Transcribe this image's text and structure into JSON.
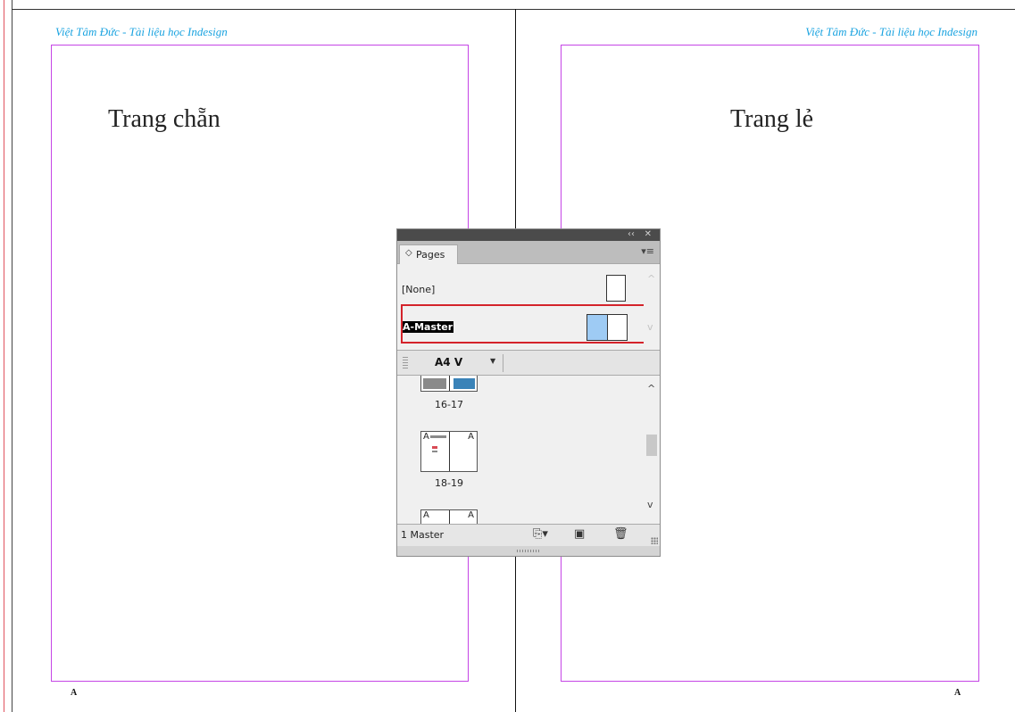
{
  "document": {
    "header_left": "Việt Tâm Đức - Tài liệu học Indesign",
    "header_right": "Việt Tâm Đức - Tài liệu học Indesign",
    "left_page_label": "Trang chẵn",
    "right_page_label": "Trang lẻ",
    "left_page_marker": "A",
    "right_page_marker": "A",
    "colors": {
      "header_text": "#1aa3e0",
      "margin_guide": "#c545e6"
    }
  },
  "pages_panel": {
    "collapse_icon": "double-left-arrow-icon",
    "collapse_glyph": "‹‹",
    "close_glyph": "✕",
    "tab_label": "Pages",
    "tab_glyph": "◇",
    "menu_glyph": "▾≡",
    "masters": [
      {
        "name": "[None]",
        "selected": false
      },
      {
        "name": "A-Master",
        "selected": true
      }
    ],
    "page_size": "A4 V",
    "page_size_arrow": "▼",
    "spreads": [
      {
        "label": "16-17"
      },
      {
        "label": "18-19",
        "left_master": "A",
        "right_master": "A"
      },
      {
        "label": "",
        "left_master": "A",
        "right_master": "A"
      }
    ],
    "footer_status": "1 Master",
    "footer_icons": {
      "new_page": "⎘▾",
      "new_master": "▣",
      "delete": "🗑"
    },
    "scroll_up": "^",
    "scroll_down": "v",
    "colors": {
      "highlight": "#d4232b",
      "master_thumb": "#9ecbf4"
    }
  }
}
